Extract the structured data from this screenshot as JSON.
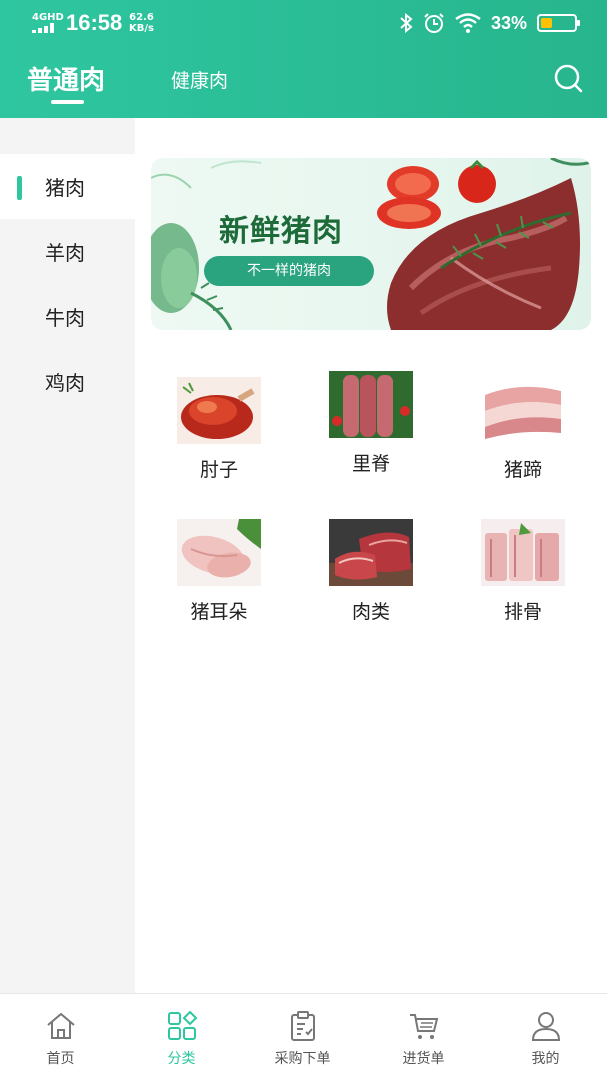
{
  "status_bar": {
    "network": "4GHD",
    "time": "16:58",
    "speed_value": "62.6",
    "speed_unit": "KB/s",
    "battery_pct": "33%",
    "battery_level": 0.33
  },
  "header": {
    "tabs": [
      {
        "label": "普通肉",
        "active": true
      },
      {
        "label": "健康肉",
        "active": false
      }
    ],
    "search_icon": "search-icon"
  },
  "sidebar": {
    "items": [
      {
        "label": "猪肉",
        "active": true
      },
      {
        "label": "羊肉",
        "active": false
      },
      {
        "label": "牛肉",
        "active": false
      },
      {
        "label": "鸡肉",
        "active": false
      }
    ]
  },
  "banner": {
    "title": "新鲜猪肉",
    "subtitle": "不一样的猪肉"
  },
  "products": [
    {
      "label": "肘子",
      "image": "roast-pork-knuckle"
    },
    {
      "label": "里脊",
      "image": "pork-tenderloin"
    },
    {
      "label": "猪蹄",
      "image": "pork-belly-strips"
    },
    {
      "label": "猪耳朵",
      "image": "pig-ear-slices"
    },
    {
      "label": "肉类",
      "image": "raw-meat-block"
    },
    {
      "label": "排骨",
      "image": "spare-ribs"
    }
  ],
  "bottom_nav": [
    {
      "label": "首页",
      "icon": "home-icon",
      "active": false
    },
    {
      "label": "分类",
      "icon": "category-grid-icon",
      "active": true
    },
    {
      "label": "采购下单",
      "icon": "clipboard-icon",
      "active": false
    },
    {
      "label": "进货单",
      "icon": "cart-icon",
      "active": false
    },
    {
      "label": "我的",
      "icon": "user-icon",
      "active": false
    }
  ],
  "colors": {
    "accent": "#2ec6a0",
    "header_bg": "#27b58d",
    "sidebar_bg": "#f4f4f4",
    "battery_fill": "#ffc107"
  }
}
